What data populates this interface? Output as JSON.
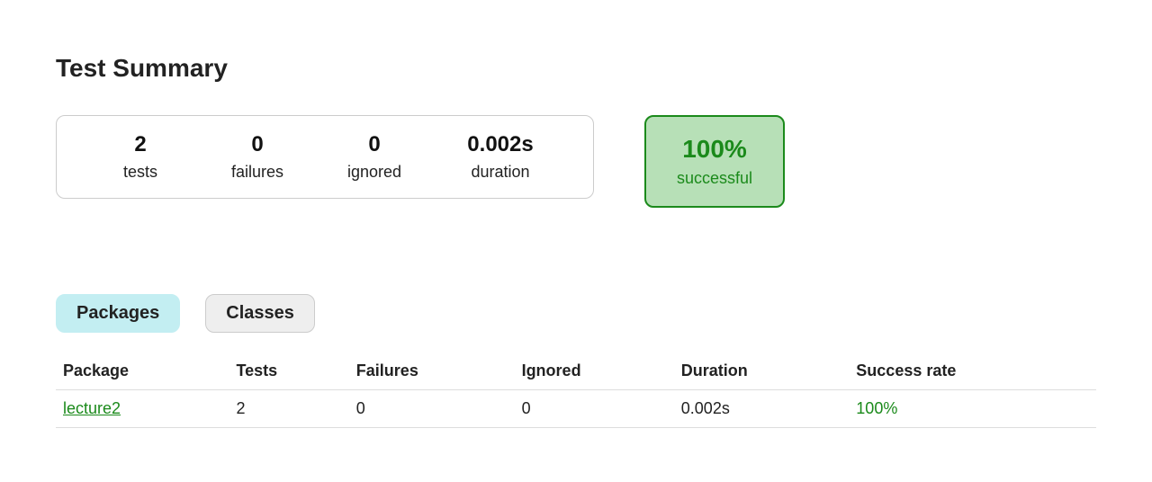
{
  "title": "Test Summary",
  "stats": {
    "tests": {
      "value": "2",
      "label": "tests"
    },
    "failures": {
      "value": "0",
      "label": "failures"
    },
    "ignored": {
      "value": "0",
      "label": "ignored"
    },
    "duration": {
      "value": "0.002s",
      "label": "duration"
    }
  },
  "success": {
    "percent": "100%",
    "label": "successful"
  },
  "tabs": {
    "packages": "Packages",
    "classes": "Classes"
  },
  "table": {
    "headers": {
      "package": "Package",
      "tests": "Tests",
      "failures": "Failures",
      "ignored": "Ignored",
      "duration": "Duration",
      "success_rate": "Success rate"
    },
    "rows": [
      {
        "package": "lecture2",
        "tests": "2",
        "failures": "0",
        "ignored": "0",
        "duration": "0.002s",
        "success_rate": "100%"
      }
    ]
  }
}
